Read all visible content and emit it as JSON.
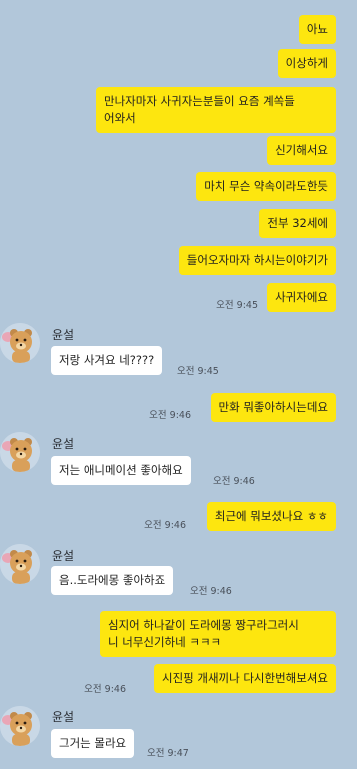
{
  "contact_name": "윤설",
  "messages": [
    {
      "text": "아뇨"
    },
    {
      "text": "이상하게"
    },
    {
      "text": "만나자마자 사귀자는분들이 요즘 계쏙들\n어와서"
    },
    {
      "text": "신기해서요"
    },
    {
      "text": "마치 무슨 약속이라도한듯"
    },
    {
      "text": "전부 32세에"
    },
    {
      "text": "들어오자마자 하시는이야기가"
    },
    {
      "text": "사귀자에요",
      "time": "오전 9:45"
    },
    {
      "text": "저랑 사겨요 네????",
      "time": "오전 9:45"
    },
    {
      "text": "만화 뭐좋아하시는데요",
      "time": "오전 9:46"
    },
    {
      "text": "저는 애니메이션 좋아해요",
      "time": "오전 9:46"
    },
    {
      "text": "최근에 뭐보셨나요 ㅎㅎ",
      "time": "오전 9:46"
    },
    {
      "text": "음..도라에몽 좋아하죠",
      "time": "오전 9:46"
    },
    {
      "text": "심지어 하나같이 도라에몽 짱구라그러시\n니 너무신기하네 ㅋㅋㅋ"
    },
    {
      "text": "시진핑 개새끼나 다시한번해보셔요",
      "time": "오전 9:46"
    },
    {
      "text": "그거는 몰라요",
      "time": "오전 9:47"
    }
  ],
  "icons": {
    "avatar": "bear-avatar-icon"
  }
}
